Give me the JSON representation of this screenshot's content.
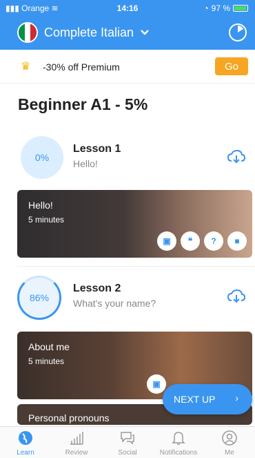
{
  "status": {
    "carrier": "Orange",
    "time": "14:16",
    "battery": "97 %"
  },
  "header": {
    "course": "Complete Italian",
    "flag_colors": [
      "#009246",
      "#ffffff",
      "#ce2b37"
    ]
  },
  "promo": {
    "text": "-30% off Premium",
    "button": "Go"
  },
  "level": {
    "title": "Beginner A1 - 5%"
  },
  "lessons": [
    {
      "progress": "0%",
      "title": "Lesson 1",
      "subtitle": "Hello!",
      "card": {
        "title": "Hello!",
        "duration": "5 minutes",
        "icons": [
          "book-icon",
          "quote-icon",
          "question-icon",
          "chat-icon"
        ]
      }
    },
    {
      "progress": "86%",
      "title": "Lesson 2",
      "subtitle": "What's your name?",
      "cards": [
        {
          "title": "About me",
          "duration": "5 minutes"
        },
        {
          "title": "Personal pronouns"
        }
      ]
    }
  ],
  "next_up": "NEXT UP",
  "tabs": [
    {
      "label": "Learn",
      "icon": "globe-icon"
    },
    {
      "label": "Review",
      "icon": "bars-icon"
    },
    {
      "label": "Social",
      "icon": "speech-icon"
    },
    {
      "label": "Notifications",
      "icon": "bell-icon"
    },
    {
      "label": "Me",
      "icon": "profile-icon"
    }
  ],
  "colors": {
    "primary": "#3a95f0",
    "accent": "#f6a623"
  }
}
